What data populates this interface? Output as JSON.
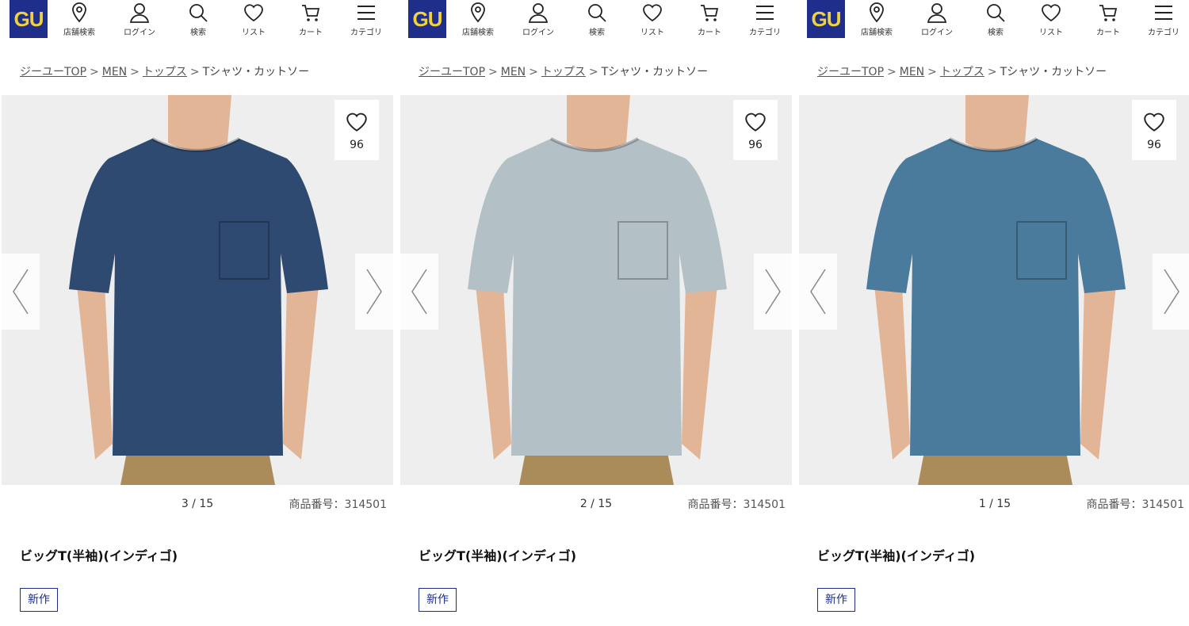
{
  "header": {
    "logo": "GU",
    "nav": [
      {
        "label": "店舗検索",
        "icon": "location-pin-icon"
      },
      {
        "label": "ログイン",
        "icon": "user-icon"
      },
      {
        "label": "検索",
        "icon": "search-icon"
      },
      {
        "label": "リスト",
        "icon": "heart-icon"
      },
      {
        "label": "カート",
        "icon": "cart-icon"
      },
      {
        "label": "カテゴリ",
        "icon": "menu-icon"
      }
    ]
  },
  "breadcrumb": {
    "items": [
      "ジーユーTOP",
      "MEN",
      "トップス"
    ],
    "current": "Tシャツ・カットソー",
    "separator": ">"
  },
  "panels": [
    {
      "favorite_count": "96",
      "pager": "3 / 15",
      "product_no": "商品番号：314501",
      "title": "ビッグT(半袖)(インディゴ)",
      "badge": "新作",
      "shirt_color": "#2f4a70"
    },
    {
      "favorite_count": "96",
      "pager": "2 / 15",
      "product_no": "商品番号：314501",
      "title": "ビッグT(半袖)(インディゴ)",
      "badge": "新作",
      "shirt_color": "#b3c0c6"
    },
    {
      "favorite_count": "96",
      "pager": "1 / 15",
      "product_no": "商品番号：314501",
      "title": "ビッグT(半袖)(インディゴ)",
      "badge": "新作",
      "shirt_color": "#4a7a9c"
    }
  ],
  "colors": {
    "brand": "#1e2e8a",
    "logo_text": "#f2d23a",
    "pants": "#a98c5a",
    "skin": "#e2b596",
    "background": "#eeeeee"
  }
}
